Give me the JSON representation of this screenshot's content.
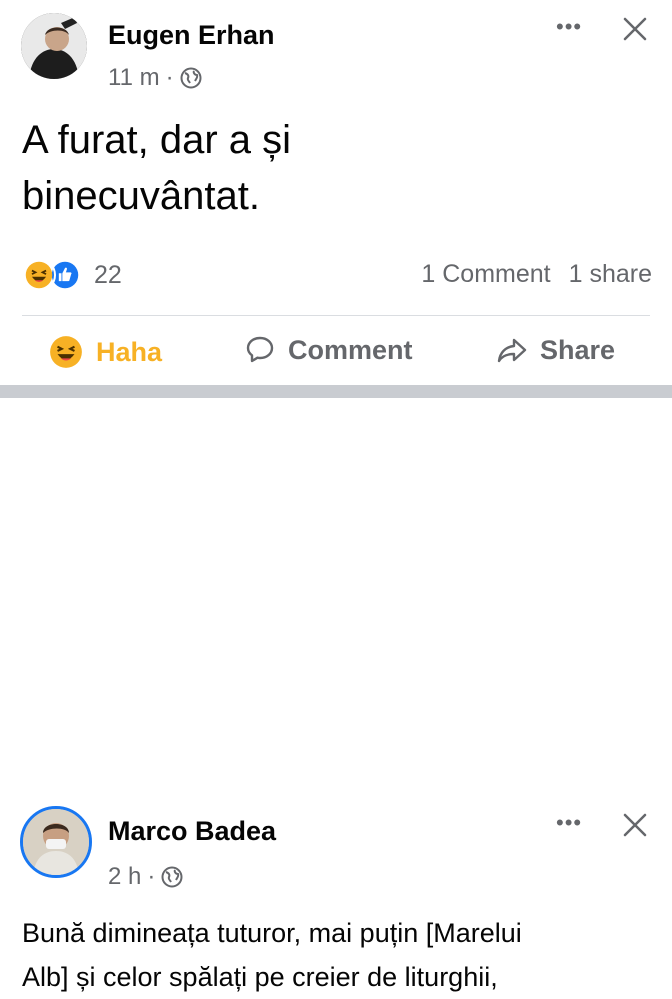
{
  "posts": [
    {
      "author": "Eugen Erhan",
      "time": "11 m",
      "dot": "·",
      "text_lines": [
        "A furat, dar a și",
        "binecuvântat."
      ],
      "reaction_count": "22",
      "comments": "1 Comment",
      "shares": "1 share",
      "actions": {
        "haha": "Haha",
        "comment": "Comment",
        "share": "Share"
      }
    },
    {
      "author": "Marco Badea",
      "time": "2 h",
      "dot": "·",
      "text_lines": [
        "Bună dimineața tuturor, mai puțin [Marelui",
        "Alb] și celor spălați pe creier de liturghii,"
      ]
    }
  ],
  "icons": {
    "more": "more-options-icon",
    "close": "close-icon",
    "globe": "globe-icon",
    "haha": "haha-reaction-icon",
    "like": "like-reaction-icon",
    "comment": "comment-icon",
    "share": "share-arrow-icon"
  },
  "colors": {
    "brand_blue": "#1877f2",
    "haha_yellow": "#f7b125",
    "secondary_text": "#65676b",
    "separator": "#c9ccd1"
  }
}
